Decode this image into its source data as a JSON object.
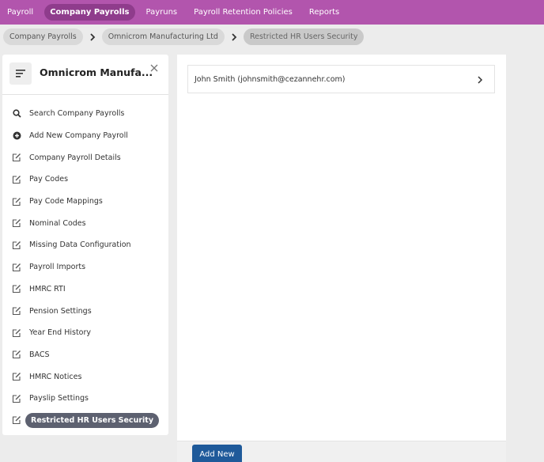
{
  "topnav": {
    "items": [
      {
        "label": "Payroll",
        "active": false
      },
      {
        "label": "Company Payrolls",
        "active": true
      },
      {
        "label": "Payruns",
        "active": false
      },
      {
        "label": "Payroll Retention Policies",
        "active": false
      },
      {
        "label": "Reports",
        "active": false
      }
    ],
    "bg_color": "#b255ad",
    "active_color": "#8f3c8c"
  },
  "breadcrumb": {
    "items": [
      "Company Payrolls",
      "Omnicrom Manufacturing Ltd",
      "Restricted HR Users Security"
    ]
  },
  "sidebar": {
    "title": "Omnicrom Manufa...",
    "menu_icon": "hamburger-icon",
    "close_icon": "close-icon",
    "items": [
      {
        "label": "Search Company Payrolls",
        "icon": "search-icon"
      },
      {
        "label": "Add New Company Payroll",
        "icon": "plus-circle-icon"
      },
      {
        "label": "Company Payroll Details",
        "icon": "edit-icon"
      },
      {
        "label": "Pay Codes",
        "icon": "edit-icon"
      },
      {
        "label": "Pay Code Mappings",
        "icon": "edit-icon"
      },
      {
        "label": "Nominal Codes",
        "icon": "edit-icon"
      },
      {
        "label": "Missing Data Configuration",
        "icon": "edit-icon"
      },
      {
        "label": "Payroll Imports",
        "icon": "edit-icon"
      },
      {
        "label": "HMRC RTI",
        "icon": "edit-icon"
      },
      {
        "label": "Pension Settings",
        "icon": "edit-icon"
      },
      {
        "label": "Year End History",
        "icon": "edit-icon"
      },
      {
        "label": "BACS",
        "icon": "edit-icon"
      },
      {
        "label": "HMRC Notices",
        "icon": "edit-icon"
      },
      {
        "label": "Payslip Settings",
        "icon": "edit-icon"
      },
      {
        "label": "Restricted HR Users Security",
        "icon": "edit-icon",
        "active": true
      }
    ]
  },
  "main": {
    "users": [
      {
        "label": "John Smith (johnsmith@cezannehr.com)"
      }
    ]
  },
  "footer": {
    "add_button_label": "Add New",
    "button_color": "#1f5a9a"
  }
}
